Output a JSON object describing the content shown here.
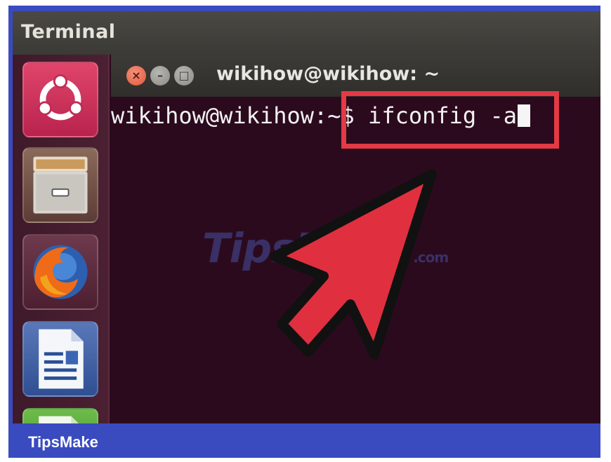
{
  "topbar": {
    "title": "Terminal"
  },
  "launcher": {
    "items": [
      {
        "name": "ubuntu-dash",
        "icon": "ubuntu-logo-icon"
      },
      {
        "name": "files",
        "icon": "file-cabinet-icon"
      },
      {
        "name": "firefox",
        "icon": "firefox-icon"
      },
      {
        "name": "libreoffice-writer",
        "icon": "document-icon"
      },
      {
        "name": "libreoffice-calc",
        "icon": "spreadsheet-icon"
      }
    ]
  },
  "window": {
    "title": "wikihow@wikihow: ~",
    "close_glyph": "×",
    "min_glyph": "–",
    "max_glyph": "□"
  },
  "terminal": {
    "prompt": "wikihow@wikihow:~$ ifconfig -a"
  },
  "watermark": {
    "text": "TipsMake",
    "suffix": ".com"
  },
  "footer": {
    "brand": "TipsMake"
  },
  "colors": {
    "frame": "#3a4bc0",
    "terminal_bg": "#2c0a1e",
    "highlight": "#e33a45"
  }
}
